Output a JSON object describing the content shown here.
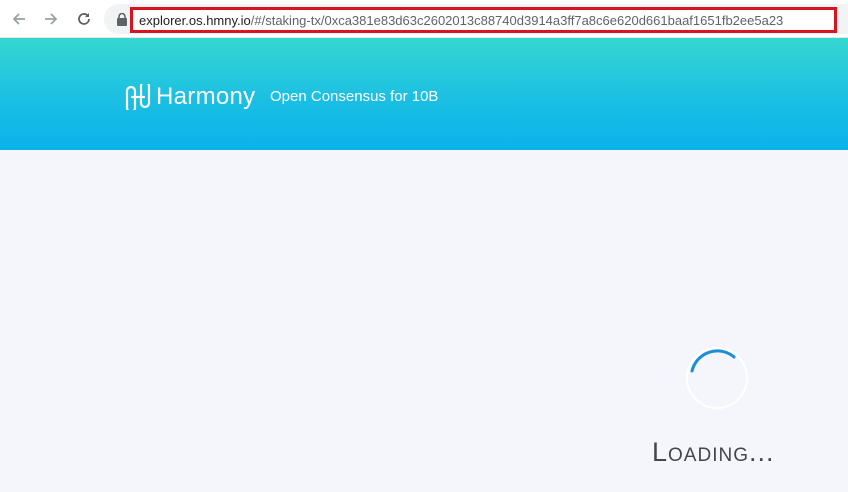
{
  "browser": {
    "url_host": "explorer.os.hmny.io",
    "url_path": "/#/staking-tx/0xca381e83d63c2602013c88740d3914a3ff7a8c6e620d661baaf1651fb2ee5a23"
  },
  "header": {
    "logo_text": "Harmony",
    "tagline": "Open Consensus for 10B"
  },
  "main": {
    "loading_text": "Loading..."
  },
  "colors": {
    "header_top": "#35d7d0",
    "header_bottom": "#0ab2ea",
    "background": "#f5f6fc",
    "spinner": "#1a8fd6",
    "url_highlight": "#d8151f"
  }
}
